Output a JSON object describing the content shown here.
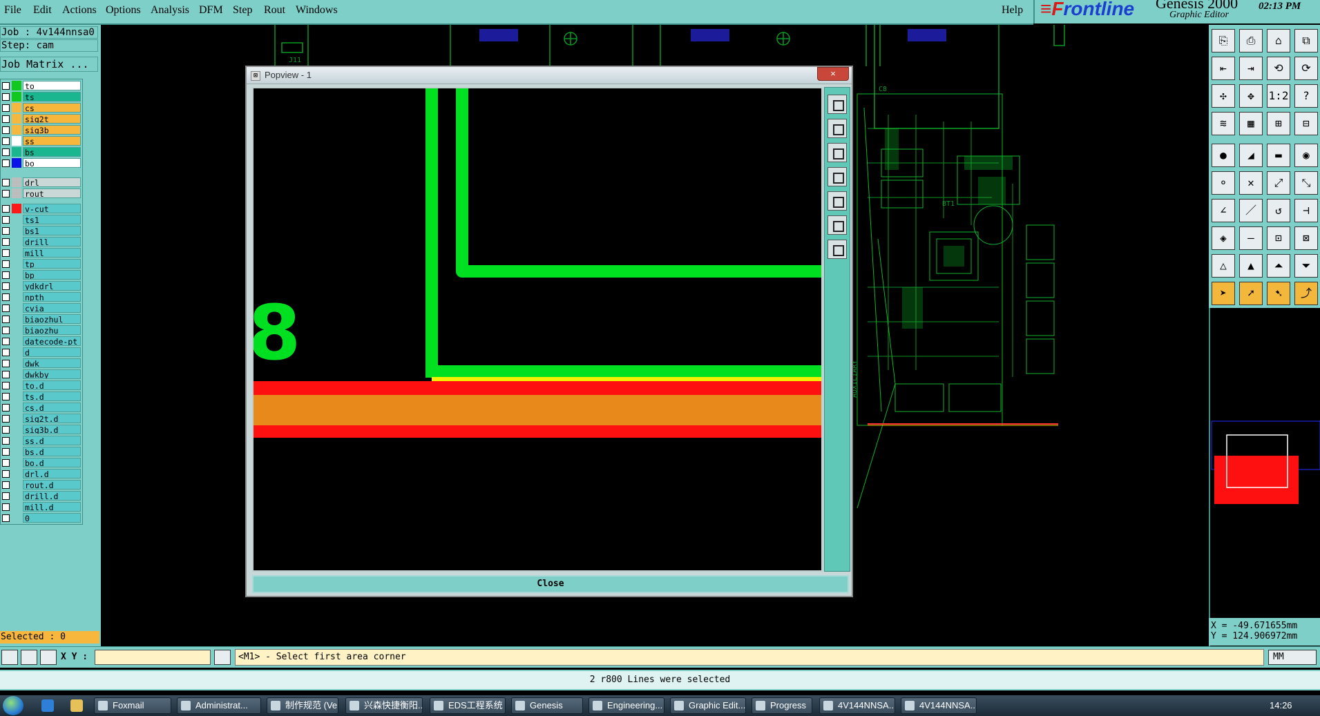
{
  "menu": {
    "items": [
      "File",
      "Edit",
      "Actions",
      "Options",
      "Analysis",
      "DFM",
      "Step",
      "Rout",
      "Windows"
    ],
    "help": "Help"
  },
  "brand": {
    "logo_a": "F",
    "logo_b": "r",
    "logo_rest": "ontline",
    "product": "Genesis 2000",
    "subtitle": "Graphic Editor",
    "time": "02:13 PM"
  },
  "job": {
    "job_line": "Job : 4v144nnsa0",
    "step_line": "Step: cam",
    "matrix_button": "Job Matrix ..."
  },
  "layers": [
    {
      "name": "to",
      "color": "#12c81e",
      "bg": "#ffffff"
    },
    {
      "name": "ts",
      "color": "#12c81e",
      "bg": "#19b68f"
    },
    {
      "name": "cs",
      "color": "#f6b73c",
      "bg": "#f6b73c"
    },
    {
      "name": "sig2t",
      "color": "#f6b73c",
      "bg": "#f6b73c"
    },
    {
      "name": "sig3b",
      "color": "#f6b73c",
      "bg": "#f6b73c"
    },
    {
      "name": "ss",
      "color": "#ffffff",
      "bg": "#f6b73c"
    },
    {
      "name": "bs",
      "color": "#19b68f",
      "bg": "#19b68f"
    },
    {
      "name": "bo",
      "color": "#0a14e6",
      "bg": "#ffffff"
    },
    {
      "name": "drl",
      "color": "#bdbdbd",
      "bg": "#c9d7d7"
    },
    {
      "name": "rout",
      "color": "#bdbdbd",
      "bg": "#c9d7d7"
    },
    {
      "name": "v-cut",
      "color": "#ff1a1a",
      "bg": "#59c9cc"
    },
    {
      "name": "ts1",
      "color": "",
      "bg": "#59c9cc"
    },
    {
      "name": "bs1",
      "color": "",
      "bg": "#59c9cc"
    },
    {
      "name": "drill",
      "color": "",
      "bg": "#59c9cc"
    },
    {
      "name": "mill",
      "color": "",
      "bg": "#59c9cc"
    },
    {
      "name": "tp",
      "color": "",
      "bg": "#59c9cc"
    },
    {
      "name": "bp",
      "color": "",
      "bg": "#59c9cc"
    },
    {
      "name": "ydkdrl",
      "color": "",
      "bg": "#59c9cc"
    },
    {
      "name": "npth",
      "color": "",
      "bg": "#59c9cc"
    },
    {
      "name": "cvia",
      "color": "",
      "bg": "#59c9cc"
    },
    {
      "name": "biaozhul",
      "color": "",
      "bg": "#59c9cc"
    },
    {
      "name": "biaozhu",
      "color": "",
      "bg": "#59c9cc"
    },
    {
      "name": "datecode-pt",
      "color": "",
      "bg": "#59c9cc"
    },
    {
      "name": "d",
      "color": "",
      "bg": "#59c9cc"
    },
    {
      "name": "dwk",
      "color": "",
      "bg": "#59c9cc"
    },
    {
      "name": "dwkby",
      "color": "",
      "bg": "#59c9cc"
    },
    {
      "name": "to.d",
      "color": "",
      "bg": "#59c9cc"
    },
    {
      "name": "ts.d",
      "color": "",
      "bg": "#59c9cc"
    },
    {
      "name": "cs.d",
      "color": "",
      "bg": "#59c9cc"
    },
    {
      "name": "sig2t.d",
      "color": "",
      "bg": "#59c9cc"
    },
    {
      "name": "sig3b.d",
      "color": "",
      "bg": "#59c9cc"
    },
    {
      "name": "ss.d",
      "color": "",
      "bg": "#59c9cc"
    },
    {
      "name": "bs.d",
      "color": "",
      "bg": "#59c9cc"
    },
    {
      "name": "bo.d",
      "color": "",
      "bg": "#59c9cc"
    },
    {
      "name": "drl.d",
      "color": "",
      "bg": "#59c9cc"
    },
    {
      "name": "rout.d",
      "color": "",
      "bg": "#59c9cc"
    },
    {
      "name": "drill.d",
      "color": "",
      "bg": "#59c9cc"
    },
    {
      "name": "mill.d",
      "color": "",
      "bg": "#59c9cc"
    },
    {
      "name": "0",
      "color": "",
      "bg": "#59c9cc"
    }
  ],
  "selected_count": "Selected : 0",
  "canvas_labels": {
    "j11": "J11",
    "c8": "C8",
    "bt1": "BT1",
    "auxiliary": "AUXILIARY"
  },
  "popup": {
    "title": "Popview - 1",
    "close_x": "×",
    "close_button": "Close",
    "glyph": "8"
  },
  "coords": {
    "x": "X = -49.671655mm",
    "y": "Y = 124.906972mm"
  },
  "input": {
    "xy_label": "X Y :",
    "xy_value": "",
    "prompt": "<M1> - Select first area corner",
    "units": "MM"
  },
  "status": "2 r800 Lines were selected",
  "taskbar": {
    "tasks": [
      "Foxmail",
      "Administrat...",
      "制作规范 (Ve...",
      "兴森快捷衡阳...",
      "EDS工程系统",
      "Genesis",
      "Engineering...",
      "Graphic Edit...",
      "Progress",
      "4V144NNSA...",
      "4V144NNSA..."
    ],
    "clock": "14:26"
  },
  "colors": {
    "panel": "#7fcfc9",
    "trace_green": "#00e020",
    "vcut_red": "#ff1010",
    "fill_orange": "#e8891c",
    "yellow": "#f4f000"
  }
}
